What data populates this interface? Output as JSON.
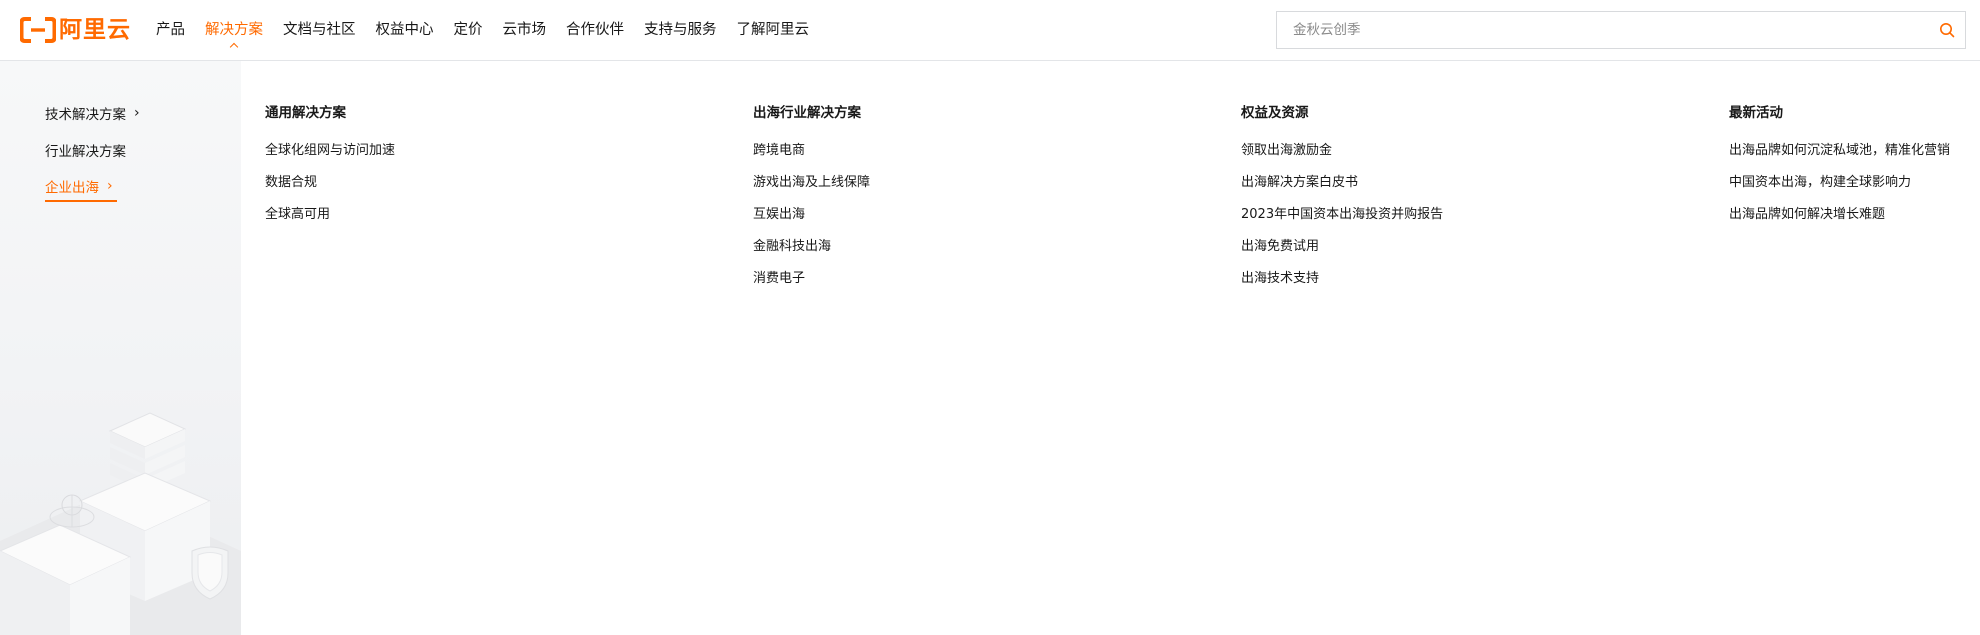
{
  "brand": {
    "name": "阿里云",
    "color": "#ff6a00"
  },
  "nav": {
    "items": [
      {
        "label": "产品",
        "active": false
      },
      {
        "label": "解决方案",
        "active": true
      },
      {
        "label": "文档与社区",
        "active": false
      },
      {
        "label": "权益中心",
        "active": false
      },
      {
        "label": "定价",
        "active": false
      },
      {
        "label": "云市场",
        "active": false
      },
      {
        "label": "合作伙伴",
        "active": false
      },
      {
        "label": "支持与服务",
        "active": false
      },
      {
        "label": "了解阿里云",
        "active": false
      }
    ]
  },
  "search": {
    "placeholder": "金秋云创季",
    "icon": "search-icon"
  },
  "sidebar": {
    "items": [
      {
        "label": "技术解决方案",
        "has_arrow": true,
        "active": false
      },
      {
        "label": "行业解决方案",
        "has_arrow": false,
        "active": false
      },
      {
        "label": "企业出海",
        "has_arrow": true,
        "active": true
      }
    ]
  },
  "menu": {
    "columns": [
      {
        "title": "通用解决方案",
        "links": [
          "全球化组网与访问加速",
          "数据合规",
          "全球高可用"
        ]
      },
      {
        "title": "出海行业解决方案",
        "links": [
          "跨境电商",
          "游戏出海及上线保障",
          "互娱出海",
          "金融科技出海",
          "消费电子"
        ]
      },
      {
        "title": "权益及资源",
        "links": [
          "领取出海激励金",
          "出海解决方案白皮书",
          "2023年中国资本出海投资并购报告",
          "出海免费试用",
          "出海技术支持"
        ]
      },
      {
        "title": "最新活动",
        "links": [
          "出海品牌如何沉淀私域池，精准化营销",
          "中国资本出海，构建全球影响力",
          "出海品牌如何解决增长难题"
        ]
      }
    ]
  }
}
